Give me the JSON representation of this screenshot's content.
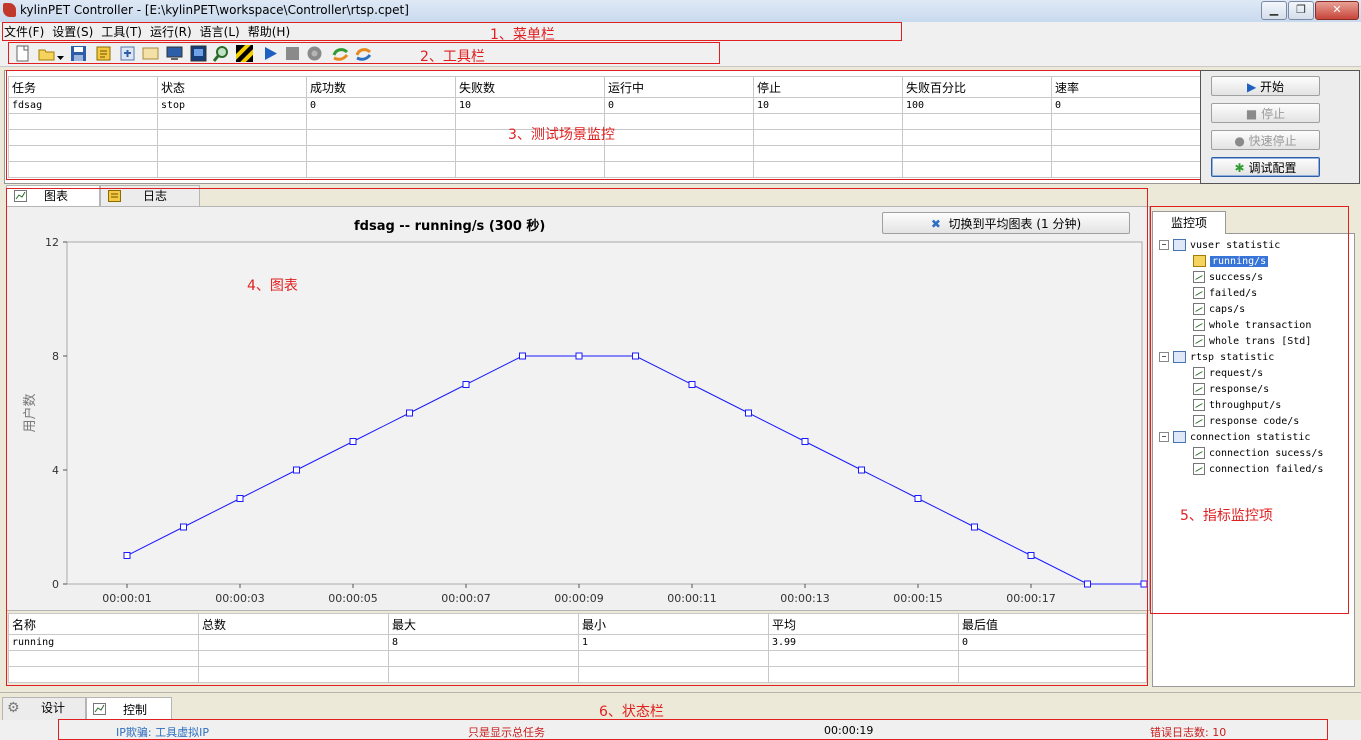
{
  "window": {
    "title": "kylinPET Controller - [E:\\kylinPET\\workspace\\Controller\\rtsp.cpet]"
  },
  "menubar": {
    "items": [
      "文件(F)",
      "设置(S)",
      "工具(T)",
      "运行(R)",
      "语言(L)",
      "帮助(H)"
    ]
  },
  "annotations": {
    "menu": "1、菜单栏",
    "toolbar": "2、工具栏",
    "scenario": "3、测试场景监控",
    "chart": "4、图表",
    "metrics": "5、指标监控项",
    "status": "6、状态栏"
  },
  "toolbar": {
    "icons": [
      "new-file-icon",
      "open-folder-icon",
      "save-icon",
      "edit-icon",
      "import-icon",
      "export-icon",
      "monitor-icon",
      "screen-icon",
      "search-icon",
      "stripe-icon",
      "play-icon",
      "stop-icon",
      "pause-icon",
      "refresh-icon",
      "sync-icon"
    ]
  },
  "scenario": {
    "columns": [
      "任务",
      "状态",
      "成功数",
      "失败数",
      "运行中",
      "停止",
      "失败百分比",
      "速率"
    ],
    "rows": [
      [
        "fdsag",
        "stop",
        "0",
        "10",
        "0",
        "10",
        "100",
        "0"
      ]
    ],
    "buttons": {
      "start": "开始",
      "stop": "停止",
      "fast_stop": "快速停止",
      "debug_config": "调试配置"
    }
  },
  "tabs": {
    "chart": "图表",
    "log": "日志"
  },
  "chart_panel": {
    "switch_button": "切换到平均图表 (1 分钟)"
  },
  "chart_data": {
    "type": "line",
    "title": "fdsag -- running/s (300 秒)",
    "ylabel": "用户数",
    "xlabel": "",
    "ylim": [
      0,
      12
    ],
    "yticks": [
      0,
      4,
      8,
      12
    ],
    "xticks": [
      "00:00:01",
      "00:00:03",
      "00:00:05",
      "00:00:07",
      "00:00:09",
      "00:00:11",
      "00:00:13",
      "00:00:15",
      "00:00:17"
    ],
    "x": [
      "00:00:01",
      "00:00:02",
      "00:00:03",
      "00:00:04",
      "00:00:05",
      "00:00:06",
      "00:00:07",
      "00:00:08",
      "00:00:09",
      "00:00:10",
      "00:00:11",
      "00:00:12",
      "00:00:13",
      "00:00:14",
      "00:00:15",
      "00:00:16",
      "00:00:17",
      "00:00:18",
      "00:00:19"
    ],
    "series": [
      {
        "values": [
          1,
          2,
          3,
          4,
          5,
          6,
          7,
          8,
          8,
          8,
          7,
          6,
          5,
          4,
          3,
          2,
          1,
          0,
          0
        ]
      }
    ],
    "color": "#1a1aff"
  },
  "stats": {
    "columns": [
      "名称",
      "总数",
      "最大",
      "最小",
      "平均",
      "最后值"
    ],
    "rows": [
      [
        "running",
        "",
        "8",
        "1",
        "3.99",
        "0"
      ]
    ]
  },
  "metrics": {
    "tab": "监控项",
    "groups": [
      {
        "label": "vuser statistic",
        "items": [
          "running/s",
          "success/s",
          "failed/s",
          "caps/s",
          "whole transaction",
          "whole trans [Std]"
        ]
      },
      {
        "label": "rtsp statistic",
        "items": [
          "request/s",
          "response/s",
          "throughput/s",
          "response code/s"
        ]
      },
      {
        "label": "connection statistic",
        "items": [
          "connection sucess/s",
          "connection failed/s"
        ]
      }
    ],
    "selected": "running/s"
  },
  "bottom_tabs": {
    "design": "设计",
    "control": "控制"
  },
  "statusbar": {
    "ip_spoof": "IP欺骗: 工具虚拟IP",
    "task_info": "只是显示总任务",
    "elapsed": "00:00:19",
    "error_log": "错误日志数: 10"
  }
}
